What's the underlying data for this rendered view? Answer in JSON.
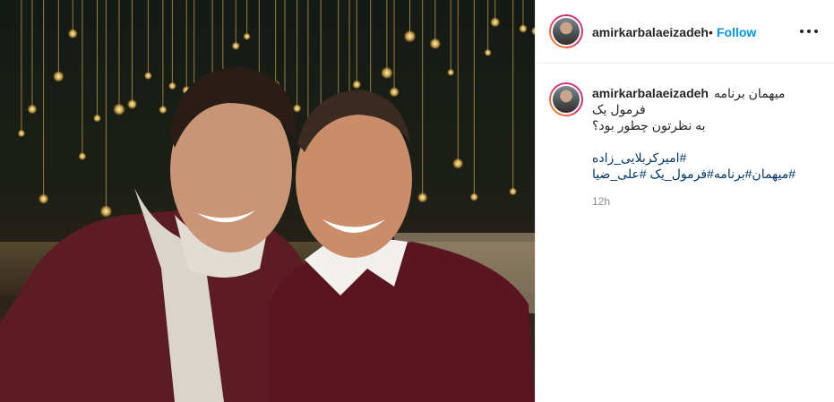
{
  "post": {
    "image_alt": "",
    "username": "amirkarbalaeizadeh",
    "separator": "•",
    "follow_label": "Follow",
    "more_icon": "more-options-icon"
  },
  "caption": {
    "username": "amirkarbalaeizadeh",
    "line1": "میهمان برنامه",
    "line2": "فرمول یک",
    "line3": "به نظرتون چطور بود؟",
    "tag1": "#امیرکربلایی_زاده",
    "tag2": "#میهمان",
    "tag3": "#برنامه",
    "tag4": "#فرمول_یک",
    "tag5": "#علی_ضیا",
    "time": "12h"
  },
  "colors": {
    "link_blue": "#0095f6",
    "hashtag": "#00376b",
    "muted": "#8e8e8e"
  }
}
